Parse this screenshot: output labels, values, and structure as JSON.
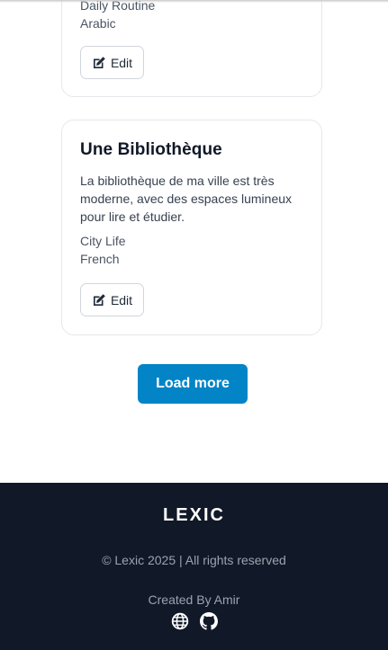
{
  "cards": [
    {
      "category": "Daily Routine",
      "language": "Arabic",
      "edit_label": "Edit"
    },
    {
      "title": "Une Bibliothèque",
      "description": "La bibliothèque de ma ville est très moderne, avec des espaces lumineux pour lire et étudier.",
      "category": "City Life",
      "language": "French",
      "edit_label": "Edit"
    }
  ],
  "load_more_label": "Load more",
  "footer": {
    "logo": "LEXIC",
    "copyright": "© Lexic 2025 | All rights reserved",
    "created_by": "Created By Amir",
    "icons": [
      "globe-icon",
      "github-icon"
    ]
  },
  "colors": {
    "accent": "#0284c7",
    "footer_bg": "#111827"
  }
}
